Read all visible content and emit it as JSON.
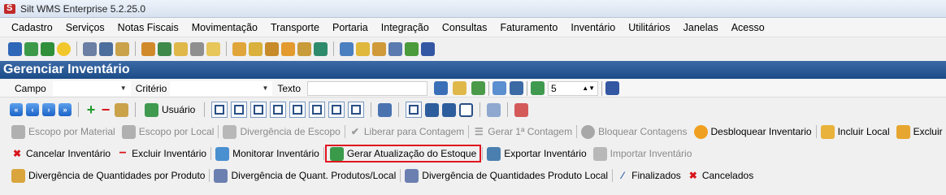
{
  "window": {
    "title": "Silt WMS Enterprise 5.2.25.0"
  },
  "menu": [
    "Cadastro",
    "Serviços",
    "Notas Fiscais",
    "Movimentação",
    "Transporte",
    "Portaria",
    "Integração",
    "Consultas",
    "Faturamento",
    "Inventário",
    "Utilitários",
    "Janelas",
    "Acesso"
  ],
  "panel": {
    "title": "Gerenciar Inventário"
  },
  "filter": {
    "campo_label": "Campo",
    "criterio_label": "Critério",
    "texto_label": "Texto",
    "spinner_value": "5"
  },
  "nav": {
    "usuario_label": "Usuário"
  },
  "row1": {
    "escopo_material": "Escopo por Material",
    "escopo_local": "Escopo por Local",
    "divergencia_escopo": "Divergência de Escopo",
    "liberar_contagem": "Liberar para Contagem",
    "gerar_contagem": "Gerar 1ª Contagem",
    "bloquear_contagens": "Bloquear Contagens",
    "desbloquear_inventario": "Desbloquear Inventario",
    "incluir_local": "Incluir Local",
    "excluir_local": "Excluir Local"
  },
  "row2": {
    "cancelar_inventario": "Cancelar Inventário",
    "excluir_inventario": "Excluir Inventário",
    "monitorar_inventario": "Monitorar Inventário",
    "gerar_atualizacao": "Gerar Atualização do Estoque",
    "exportar_inventario": "Exportar Inventário",
    "importar_inventario": "Importar Inventário"
  },
  "row3": {
    "div_quant_produto": "Divergência de Quantidades por Produto",
    "div_quant_produtos_local": "Divergência de Quant. Produtos/Local",
    "div_quant_produto_local": "Divergência de Quantidades Produto Local",
    "finalizados": "Finalizados",
    "cancelados": "Cancelados"
  },
  "colors": {
    "panel_title_bg": "#1c4c88",
    "highlight_border": "#e0151f"
  }
}
